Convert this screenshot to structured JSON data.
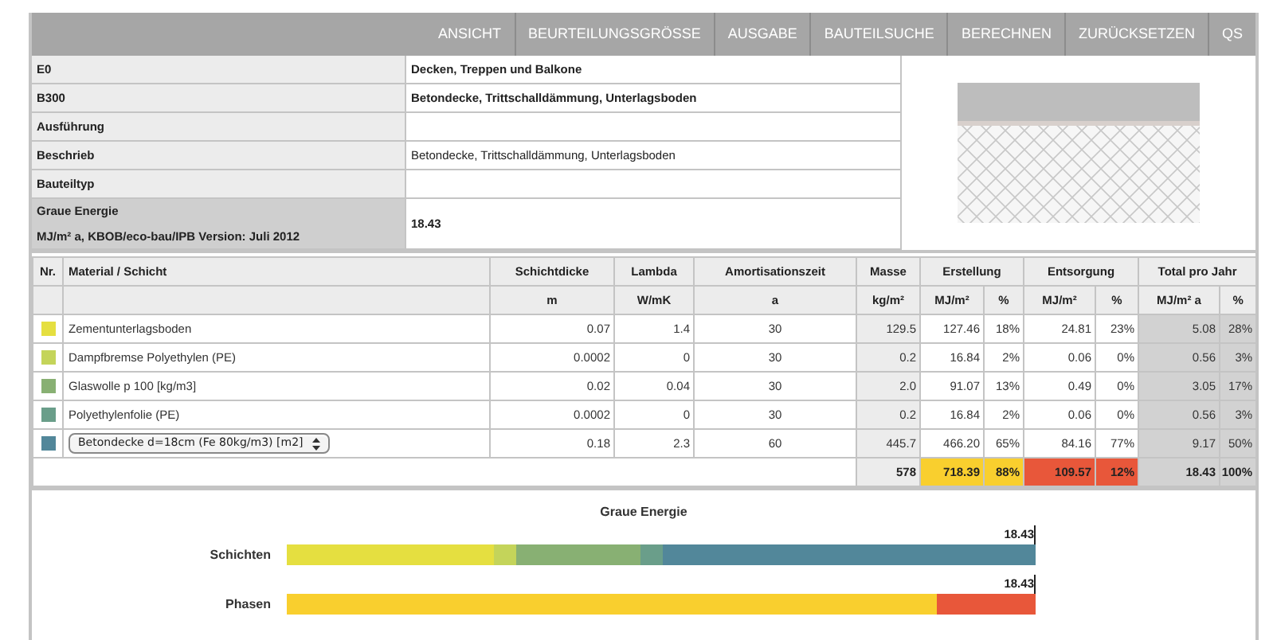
{
  "nav": [
    "ANSICHT",
    "BEURTEILUNGSGRÖSSE",
    "AUSGABE",
    "BAUTEILSUCHE",
    "BERECHNEN",
    "ZURÜCKSETZEN",
    "QS"
  ],
  "info": [
    {
      "label": "E0",
      "value": "Decken, Treppen und Balkone",
      "bold": true
    },
    {
      "label": "B300",
      "value": "Betondecke, Trittschalldämmung, Unterlagsboden",
      "bold": true
    },
    {
      "label": "Ausführung"
    },
    {
      "label": "Beschrieb",
      "value": "Betondecke, Trittschalldämmung, Unterlagsboden",
      "bold": false
    },
    {
      "label": "Bauteiltyp"
    },
    {
      "label": "Graue Energie",
      "sublabel": "MJ/m² a, KBOB/eco-bau/IPB Version: Juli 2012",
      "value": "18.43",
      "bold": true
    }
  ],
  "layers": {
    "groups": [
      "Nr.",
      "Material / Schicht",
      "Schichtdicke",
      "Lambda",
      "Amortisationszeit",
      "Masse",
      "Erstellung",
      "Entsorgung",
      "Total pro Jahr"
    ],
    "units": [
      "m",
      "W/mK",
      "a",
      "kg/m²",
      "MJ/m²",
      "%",
      "MJ/m²",
      "%",
      "MJ/m² a",
      "%"
    ],
    "rows": [
      {
        "color": "#e5df40",
        "kind": "text",
        "material": "Zementunterlagsboden",
        "cells": [
          "0.07",
          "1.4",
          "30",
          "129.5",
          "127.46",
          "18%",
          "24.81",
          "23%",
          "5.08",
          "28%"
        ]
      },
      {
        "color": "#c4d45a",
        "kind": "text",
        "material": "Dampfbremse Polyethylen (PE)",
        "cells": [
          "0.0002",
          "0",
          "30",
          "0.2",
          "16.84",
          "2%",
          "0.06",
          "0%",
          "0.56",
          "3%"
        ]
      },
      {
        "color": "#88b073",
        "kind": "text",
        "material": "Glaswolle p 100 [kg/m3]",
        "cells": [
          "0.02",
          "0.04",
          "30",
          "2.0",
          "91.07",
          "13%",
          "0.49",
          "0%",
          "3.05",
          "17%"
        ]
      },
      {
        "color": "#6a9e8a",
        "kind": "text",
        "material": "Polyethylenfolie (PE)",
        "cells": [
          "0.0002",
          "0",
          "30",
          "0.2",
          "16.84",
          "2%",
          "0.06",
          "0%",
          "0.56",
          "3%"
        ]
      },
      {
        "color": "#52879a",
        "kind": "select",
        "material": "Betondecke d=18cm (Fe 80kg/m3) [m2]",
        "cells": [
          "0.18",
          "2.3",
          "60",
          "445.7",
          "466.20",
          "65%",
          "84.16",
          "77%",
          "9.17",
          "50%"
        ]
      }
    ],
    "totals": [
      {
        "text": "578"
      },
      {
        "text": "718.39",
        "color": "#f9cf2e"
      },
      {
        "text": "88%",
        "color": "#f9cf2e"
      },
      {
        "text": "109.57",
        "color": "#e8573a"
      },
      {
        "text": "12%",
        "color": "#e8573a"
      },
      {
        "text": "18.43"
      },
      {
        "text": "100%"
      }
    ]
  },
  "chart": {
    "title": "Graue Energie",
    "bars": [
      {
        "label": "Schichten",
        "total": "18.43",
        "kind": "layers"
      },
      {
        "label": "Phasen",
        "total": "18.43",
        "kind": "phases"
      }
    ]
  }
}
